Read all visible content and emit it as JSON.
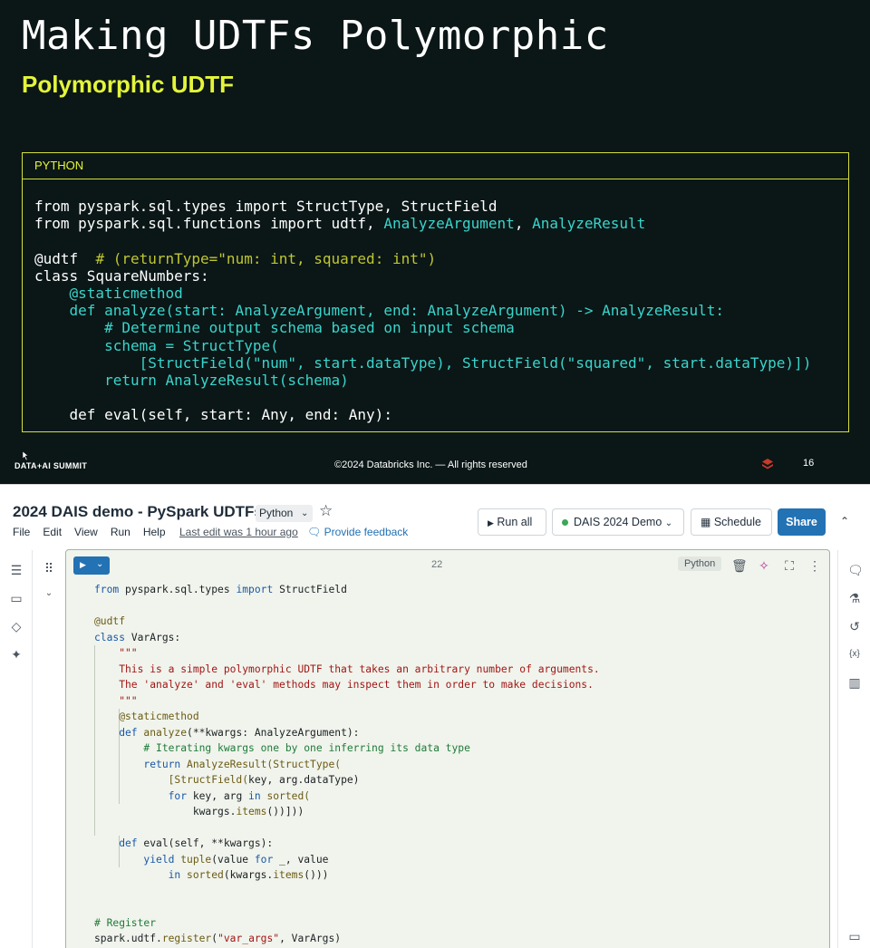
{
  "slide": {
    "title": "Making UDTFs Polymorphic",
    "subtitle": "Polymorphic UDTF",
    "code_lang": "PYTHON",
    "code_lines": [
      [
        {
          "t": "from pyspark.sql.types import StructType, StructField",
          "c": ""
        }
      ],
      [
        {
          "t": "from pyspark.sql.functions import udtf, ",
          "c": ""
        },
        {
          "t": "AnalyzeArgument",
          "c": "s-cyan"
        },
        {
          "t": ", ",
          "c": ""
        },
        {
          "t": "AnalyzeResult",
          "c": "s-cyan"
        }
      ],
      [
        {
          "t": "",
          "c": ""
        }
      ],
      [
        {
          "t": "@udtf  ",
          "c": ""
        },
        {
          "t": "# (returnType=\"num: int, squared: int\")",
          "c": "s-olive"
        }
      ],
      [
        {
          "t": "class SquareNumbers:",
          "c": ""
        }
      ],
      [
        {
          "t": "    @staticmethod",
          "c": "s-cyan"
        }
      ],
      [
        {
          "t": "    def analyze(start: AnalyzeArgument, end: AnalyzeArgument) -> AnalyzeResult:",
          "c": "s-cyan"
        }
      ],
      [
        {
          "t": "        # Determine output schema based on input schema",
          "c": "s-cyan"
        }
      ],
      [
        {
          "t": "        schema = StructType(",
          "c": "s-cyan"
        }
      ],
      [
        {
          "t": "            [StructField(\"num\", start.dataType), StructField(\"squared\", start.dataType)])",
          "c": "s-cyan"
        }
      ],
      [
        {
          "t": "        return AnalyzeResult(schema)",
          "c": "s-cyan"
        }
      ],
      [
        {
          "t": "",
          "c": ""
        }
      ],
      [
        {
          "t": "    def eval(self, start: Any, end: Any):",
          "c": ""
        }
      ]
    ],
    "footer_brand": "DATA+AI SUMMIT",
    "footer_copyright": "©2024 Databricks Inc. — All rights reserved",
    "page_number": "16"
  },
  "notebook": {
    "title": "2024 DAIS demo - PySpark UDTFs",
    "language": "Python",
    "menu": [
      "File",
      "Edit",
      "View",
      "Run",
      "Help"
    ],
    "last_edit": "Last edit was 1 hour ago",
    "feedback": "Provide feedback",
    "run_all": "Run all",
    "cluster": "DAIS 2024 Demo",
    "schedule": "Schedule",
    "share": "Share",
    "cell_number": "22",
    "cell_language": "Python",
    "code_lines": [
      [
        {
          "t": "from",
          "c": "k-blue"
        },
        {
          "t": " pyspark.sql.types ",
          "c": ""
        },
        {
          "t": "import",
          "c": "k-blue"
        },
        {
          "t": " StructField",
          "c": ""
        }
      ],
      [
        {
          "t": "",
          "c": ""
        }
      ],
      [
        {
          "t": "@udtf",
          "c": "k-dec"
        }
      ],
      [
        {
          "t": "class",
          "c": "k-blue"
        },
        {
          "t": " VarArgs:",
          "c": ""
        }
      ],
      [
        {
          "t": "    \"\"\"",
          "c": "k-red"
        }
      ],
      [
        {
          "t": "    This is a simple polymorphic UDTF that takes an arbitrary number of arguments.",
          "c": "k-red"
        }
      ],
      [
        {
          "t": "    The 'analyze' and 'eval' methods may inspect them in order to make decisions.",
          "c": "k-red"
        }
      ],
      [
        {
          "t": "    \"\"\"",
          "c": "k-red"
        }
      ],
      [
        {
          "t": "    @staticmethod",
          "c": "k-dec"
        }
      ],
      [
        {
          "t": "    def",
          "c": "k-blue"
        },
        {
          "t": " analyze",
          "c": "k-func"
        },
        {
          "t": "(**kwargs: AnalyzeArgument):",
          "c": ""
        }
      ],
      [
        {
          "t": "        # Iterating kwargs one by one inferring its data type",
          "c": "k-green"
        }
      ],
      [
        {
          "t": "        return",
          "c": "k-blue"
        },
        {
          "t": " AnalyzeResult(StructType(",
          "c": "k-func"
        }
      ],
      [
        {
          "t": "            [StructField(",
          "c": "k-func"
        },
        {
          "t": "key, arg.dataType)",
          "c": ""
        }
      ],
      [
        {
          "t": "            for",
          "c": "k-blue"
        },
        {
          "t": " key, arg ",
          "c": ""
        },
        {
          "t": "in",
          "c": "k-blue"
        },
        {
          "t": " sorted(",
          "c": "k-func"
        }
      ],
      [
        {
          "t": "                kwargs.",
          "c": ""
        },
        {
          "t": "items",
          "c": "k-func"
        },
        {
          "t": "())]))",
          "c": ""
        }
      ],
      [
        {
          "t": "",
          "c": ""
        }
      ],
      [
        {
          "t": "    def",
          "c": "k-blue"
        },
        {
          "t": " eval(self, **kwargs):",
          "c": ""
        }
      ],
      [
        {
          "t": "        yield",
          "c": "k-blue"
        },
        {
          "t": " tuple",
          "c": "k-func"
        },
        {
          "t": "(value ",
          "c": ""
        },
        {
          "t": "for",
          "c": "k-blue"
        },
        {
          "t": " _, value",
          "c": ""
        }
      ],
      [
        {
          "t": "            in",
          "c": "k-blue"
        },
        {
          "t": " sorted",
          "c": "k-func"
        },
        {
          "t": "(kwargs.",
          "c": ""
        },
        {
          "t": "items",
          "c": "k-func"
        },
        {
          "t": "()))",
          "c": ""
        }
      ],
      [
        {
          "t": "",
          "c": ""
        }
      ],
      [
        {
          "t": "",
          "c": ""
        }
      ],
      [
        {
          "t": "# Register",
          "c": "k-green"
        }
      ],
      [
        {
          "t": "spark.udtf.",
          "c": ""
        },
        {
          "t": "register",
          "c": "k-func"
        },
        {
          "t": "(",
          "c": ""
        },
        {
          "t": "\"var_args\"",
          "c": "k-red"
        },
        {
          "t": ", VarArgs)",
          "c": ""
        }
      ]
    ]
  }
}
